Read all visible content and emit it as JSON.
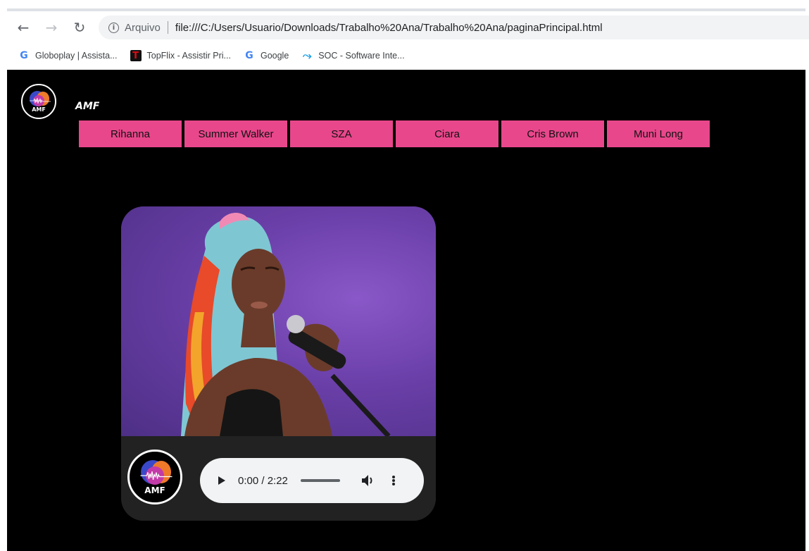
{
  "browser": {
    "scheme_label": "Arquivo",
    "url": "file:///C:/Users/Usuario/Downloads/Trabalho%20Ana/Trabalho%20Ana/paginaPrincipal.html",
    "icons": {
      "back": "arrow-left-icon",
      "forward": "arrow-right-icon",
      "reload": "reload-icon",
      "info": "info-icon"
    },
    "bookmarks": [
      {
        "label": "Globoplay | Assista...",
        "icon": "google-icon"
      },
      {
        "label": "TopFlix - Assistir Pri...",
        "icon": "topflix-icon"
      },
      {
        "label": "Google",
        "icon": "google-icon"
      },
      {
        "label": "SOC - Software Inte...",
        "icon": "soc-icon"
      }
    ]
  },
  "page": {
    "logo_text": "AMF",
    "brand_title": "AMF",
    "artists": [
      "Rihanna",
      "Summer Walker",
      "SZA",
      "Ciara",
      "Cris Brown",
      "Muni Long"
    ],
    "player": {
      "time": "0:00 / 2:22",
      "progress": 0,
      "icons": {
        "play": "play-icon",
        "volume": "volume-icon",
        "menu": "more-vert-icon"
      }
    },
    "colors": {
      "page_background": "#000000",
      "nav_button": "#e8478b",
      "player_background": "#222222",
      "audio_control": "#f1f3f4"
    }
  }
}
